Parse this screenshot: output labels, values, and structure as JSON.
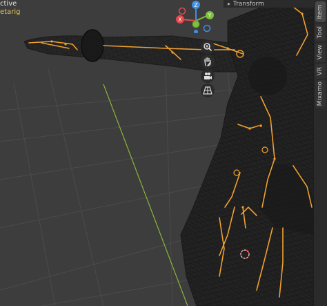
{
  "viewport": {
    "mode_text": "ctive",
    "object_text": "etarig"
  },
  "nav_gizmo": {
    "axes": [
      "Z",
      "X",
      "Y"
    ],
    "colors": {
      "x": "#e5484d",
      "y": "#7fbf3f",
      "z": "#3f8fe5",
      "grid": "#88b73a",
      "bone": "#f0a030"
    }
  },
  "tools": [
    "zoom-icon",
    "hand-pan-icon",
    "camera-icon",
    "grid-perspective-icon"
  ],
  "properties_panel": {
    "header": "Transform"
  },
  "side_tabs": [
    "Item",
    "Tool",
    "View",
    "VR",
    "Mixamo"
  ]
}
